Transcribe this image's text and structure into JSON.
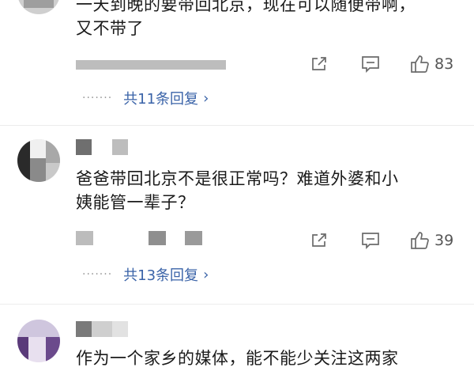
{
  "comments": [
    {
      "text_lines": [
        "一天到晚的要带回北京，现在可以随便带啊，",
        "又不带了"
      ],
      "share_icon": "share-icon",
      "comment_icon": "comment-icon",
      "like_icon": "thumbs-up-icon",
      "like_count": "83",
      "replies_dots": "·······",
      "replies_label": "共11条回复",
      "replies_chevron": "›"
    },
    {
      "text_lines": [
        "爸爸带回北京不是很正常吗？难道外婆和小",
        "姨能管一辈子？"
      ],
      "share_icon": "share-icon",
      "comment_icon": "comment-icon",
      "like_icon": "thumbs-up-icon",
      "like_count": "39",
      "replies_dots": "·······",
      "replies_label": "共13条回复",
      "replies_chevron": "›"
    },
    {
      "text_lines": [
        "作为一个家乡的媒体，能不能少关注这两家"
      ]
    }
  ],
  "colors": {
    "reply_link": "#3a63a8",
    "icon_gray": "#6b6b6b",
    "divider": "#ececec"
  }
}
